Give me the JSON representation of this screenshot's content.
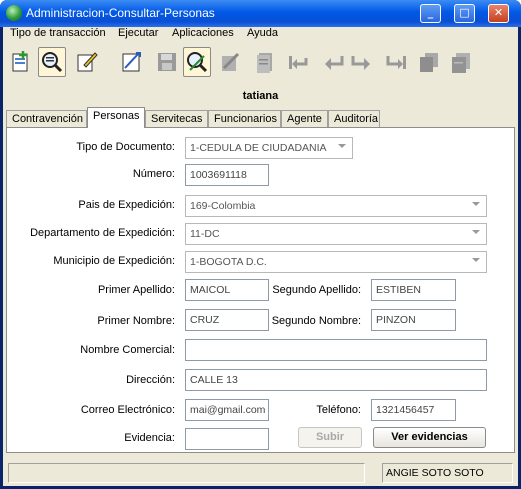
{
  "window": {
    "title": "Administracion-Consultar-Personas"
  },
  "menu": [
    "Tipo de transacción",
    "Ejecutar",
    "Aplicaciones",
    "Ayuda"
  ],
  "toolbar": {
    "icons": [
      "new-record-icon",
      "query-icon",
      "edit-icon",
      "execute-icon",
      "save-icon",
      "query-person-icon",
      "cancel-query-icon",
      "print-icon",
      "first-record-icon",
      "previous-record-icon",
      "next-record-icon",
      "last-record-icon",
      "copy-icon",
      "report-icon"
    ],
    "active_icon": "query-icon"
  },
  "user": {
    "name": "tatiana"
  },
  "tabs": [
    "Contravención",
    "Personas",
    "Servitecas",
    "Funcionarios",
    "Agente",
    "Auditoría"
  ],
  "active_tab": "Personas",
  "form": {
    "tipo_documento": {
      "label": "Tipo de Documento:",
      "value": "1-CEDULA DE CIUDADANIA"
    },
    "numero": {
      "label": "Número:",
      "value": "1003691118"
    },
    "pais": {
      "label": "Pais de Expedición:",
      "value": "169-Colombia"
    },
    "departamento": {
      "label": "Departamento de Expedición:",
      "value": "11-DC"
    },
    "municipio": {
      "label": "Municipio de Expedición:",
      "value": "1-BOGOTA D.C."
    },
    "primer_apellido": {
      "label": "Primer Apellido:",
      "value": "MAICOL"
    },
    "segundo_apellido": {
      "label": "Segundo Apellido:",
      "value": "ESTIBEN"
    },
    "primer_nombre": {
      "label": "Primer Nombre:",
      "value": "CRUZ"
    },
    "segundo_nombre": {
      "label": "Segundo Nombre:",
      "value": "PINZON"
    },
    "nombre_comercial": {
      "label": "Nombre Comercial:",
      "value": ""
    },
    "direccion": {
      "label": "Dirección:",
      "value": "CALLE 13"
    },
    "correo": {
      "label": "Correo Electrónico:",
      "value": "mai@gmail.com"
    },
    "telefono": {
      "label": "Teléfono:",
      "value": "1321456457"
    },
    "evidencia": {
      "label": "Evidencia:",
      "value": ""
    }
  },
  "buttons": {
    "subir": "Subir",
    "ver_evidencias": "Ver evidencias"
  },
  "status": {
    "left": "",
    "user": "ANGIE  SOTO SOTO"
  }
}
